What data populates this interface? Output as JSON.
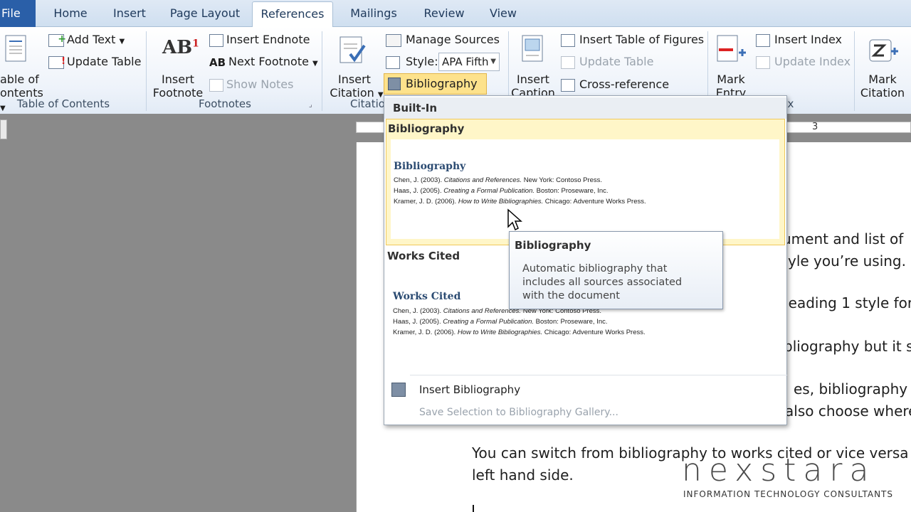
{
  "tabs": {
    "file": "File",
    "home": "Home",
    "insert": "Insert",
    "page_layout": "Page Layout",
    "references": "References",
    "mailings": "Mailings",
    "review": "Review",
    "view": "View"
  },
  "ribbon": {
    "toc": {
      "label_line1": "able of",
      "label_line2": "ontents",
      "group": "Table of Contents",
      "add_text": "Add Text",
      "update_table": "Update Table"
    },
    "footnotes": {
      "insert_footnote_1": "Insert",
      "insert_footnote_2": "Footnote",
      "insert_endnote": "Insert Endnote",
      "next_footnote": "Next Footnote",
      "show_notes": "Show Notes",
      "group": "Footnotes"
    },
    "citations": {
      "insert_citation_1": "Insert",
      "insert_citation_2": "Citation",
      "manage_sources": "Manage Sources",
      "style_label": "Style:",
      "style_value": "APA Fifth",
      "bibliography": "Bibliography",
      "group": "Citatio"
    },
    "captions": {
      "insert_caption_1": "Insert",
      "insert_caption_2": "Caption",
      "insert_table_of_figures": "Insert Table of Figures",
      "update_table": "Update Table",
      "cross_reference": "Cross-reference"
    },
    "index": {
      "mark_entry_1": "Mark",
      "mark_entry_2": "Entry",
      "insert_index": "Insert Index",
      "update_index": "Update Index",
      "group": "x"
    },
    "toa": {
      "mark_citation_1": "Mark",
      "mark_citation_2": "Citation"
    }
  },
  "dropdown": {
    "builtin_header": "Built-In",
    "item1": {
      "label": "Bibliography",
      "preview_title": "Bibliography",
      "lines": [
        {
          "a": "Chen, J. (2003). ",
          "b": "Citations and References.",
          "c": " New York: Contoso Press."
        },
        {
          "a": "Haas, J. (2005). ",
          "b": "Creating a Formal Publication.",
          "c": " Boston: Proseware, Inc."
        },
        {
          "a": "Kramer, J. D. (2006). ",
          "b": "How to Write Bibliographies.",
          "c": " Chicago: Adventure Works Press."
        }
      ]
    },
    "item2": {
      "label": "Works Cited",
      "preview_title": "Works Cited",
      "lines": [
        {
          "a": "Chen, J. (2003). ",
          "b": "Citations and References.",
          "c": " New York: Contoso Press."
        },
        {
          "a": "Haas, J. (2005). ",
          "b": "Creating a Formal Publication.",
          "c": " Boston: Proseware, Inc."
        },
        {
          "a": "Kramer, J. D. (2006). ",
          "b": "How to Write Bibliographies.",
          "c": " Chicago: Adventure Works Press."
        }
      ]
    },
    "insert_bibliography": "Insert Bibliography",
    "save_selection": "Save Selection to Bibliography Gallery..."
  },
  "tooltip": {
    "title": "Bibliography",
    "body_1": "Automatic bibliography that",
    "body_2": "includes all sources associated",
    "body_3": "with the document"
  },
  "document": {
    "line1": "ument and list of",
    "line2": "yle you’re using.",
    "line3": "heading 1 style for",
    "line4": "bliography but it s",
    "line5": "es, bibliography t",
    "line6": "also choose where",
    "line7": "You can switch from bibliography to works cited or vice versa",
    "line8": "left hand side."
  },
  "ruler": {
    "mark": "3"
  },
  "brand": {
    "logo_text": "nexstara",
    "tagline": "INFORMATION TECHNOLOGY CONSULTANTS"
  },
  "colors": {
    "accent_highlight": "#fde68a",
    "file_tab": "#2a5fa8",
    "ribbon_text": "#1e395b"
  }
}
